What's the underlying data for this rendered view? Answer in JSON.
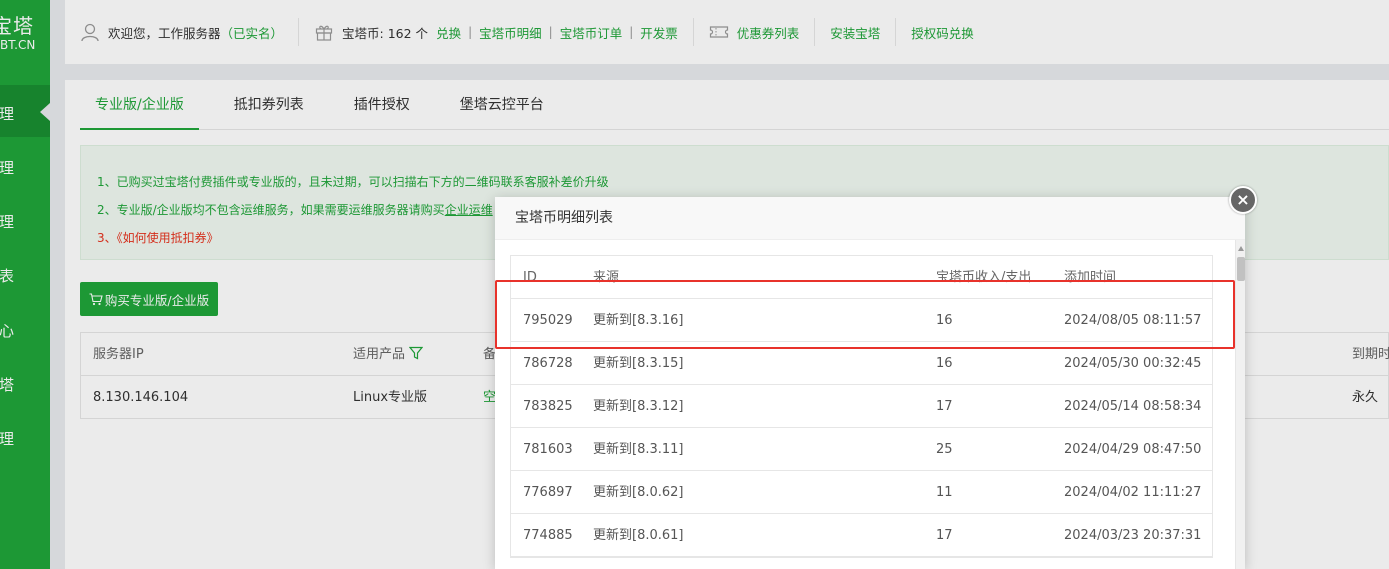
{
  "sidebar": {
    "logo_main": "宝塔",
    "logo_sub": "BT.CN",
    "items": [
      "管理",
      "管理",
      "管理",
      "列表",
      "中心",
      "宝塔",
      "管理"
    ]
  },
  "header": {
    "welcome": "欢迎您，工作服务器",
    "verified": "（已实名）",
    "coin_text": "宝塔币: 162 个",
    "redeem": "兑换",
    "coin_detail": "宝塔币明细",
    "coin_order": "宝塔币订单",
    "invoice": "开发票",
    "coupon_list": "优惠券列表",
    "install": "安装宝塔",
    "auth_code": "授权码兑换"
  },
  "tabs": [
    "专业版/企业版",
    "抵扣券列表",
    "插件授权",
    "堡塔云控平台"
  ],
  "notice": {
    "line1": "1、已购买过宝塔付费插件或专业版的，且未过期，可以扫描右下方的二维码联系客服补差价升级",
    "line2_pre": "2、专业版/企业版均不包含运维服务，如果需要运维服务器请购买",
    "line2_link": "企业运维",
    "line3": "3、《如何使用抵扣券》"
  },
  "buy_button": "购买专业版/企业版",
  "server_table": {
    "headers": {
      "ip": "服务器IP",
      "product": "适用产品",
      "remark": "备",
      "expire": "到期时"
    },
    "row": {
      "ip": "8.130.146.104",
      "product": "Linux专业版",
      "remark": "空",
      "expire": "永久"
    }
  },
  "modal": {
    "title": "宝塔币明细列表",
    "close": "×",
    "headers": {
      "id": "ID",
      "source": "来源",
      "amount": "宝塔币收入/支出",
      "time": "添加时间"
    },
    "rows": [
      {
        "id": "795029",
        "source": "更新到[8.3.16]",
        "amount": "16",
        "time": "2024/08/05 08:11:57"
      },
      {
        "id": "786728",
        "source": "更新到[8.3.15]",
        "amount": "16",
        "time": "2024/05/30 00:32:45"
      },
      {
        "id": "783825",
        "source": "更新到[8.3.12]",
        "amount": "17",
        "time": "2024/05/14 08:58:34"
      },
      {
        "id": "781603",
        "source": "更新到[8.3.11]",
        "amount": "25",
        "time": "2024/04/29 08:47:50"
      },
      {
        "id": "776897",
        "source": "更新到[8.0.62]",
        "amount": "11",
        "time": "2024/04/02 11:11:27"
      },
      {
        "id": "774885",
        "source": "更新到[8.0.61]",
        "amount": "17",
        "time": "2024/03/23 20:37:31"
      }
    ]
  },
  "colors": {
    "brand": "#20a53a",
    "highlight": "#e8322b"
  }
}
